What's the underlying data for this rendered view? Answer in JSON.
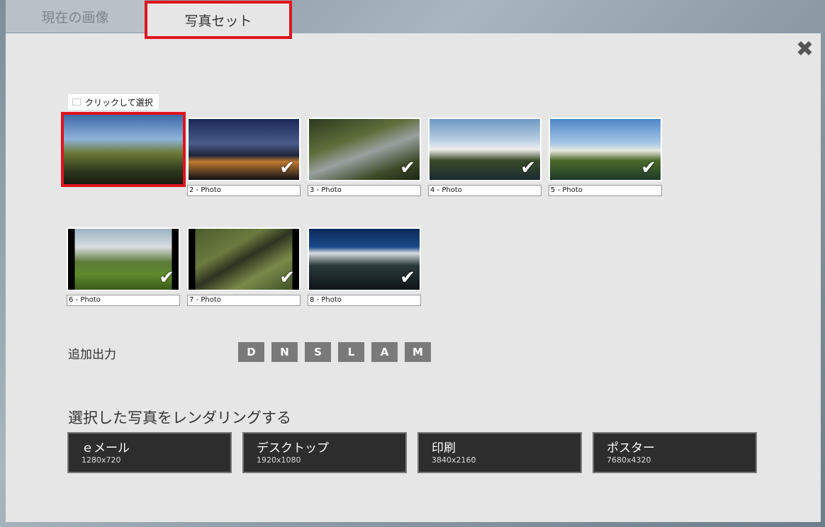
{
  "tabs": {
    "current": "現在の画像",
    "photo_set": "写真セット"
  },
  "hint": "クリックして選択",
  "photos": [
    {
      "label": "",
      "checked": false
    },
    {
      "label": "2 - Photo",
      "checked": true
    },
    {
      "label": "3 - Photo",
      "checked": true
    },
    {
      "label": "4 - Photo",
      "checked": true
    },
    {
      "label": "5 - Photo",
      "checked": true
    },
    {
      "label": "6 - Photo",
      "checked": true
    },
    {
      "label": "7 - Photo",
      "checked": true
    },
    {
      "label": "8 - Photo",
      "checked": true
    }
  ],
  "extra_output": {
    "label": "追加出力",
    "letters": [
      "D",
      "N",
      "S",
      "L",
      "A",
      "M"
    ]
  },
  "render": {
    "title": "選択した写真をレンダリングする",
    "buttons": [
      {
        "name": "ｅメール",
        "size": "1280x720"
      },
      {
        "name": "デスクトップ",
        "size": "1920x1080"
      },
      {
        "name": "印刷",
        "size": "3840x2160"
      },
      {
        "name": "ポスター",
        "size": "7680x4320"
      }
    ]
  },
  "icons": {
    "close": "close-icon",
    "check": "checkmark-icon"
  },
  "colors": {
    "highlight": "#e0141e",
    "panel": "#e6e6e6",
    "button": "#2d2d2d"
  }
}
